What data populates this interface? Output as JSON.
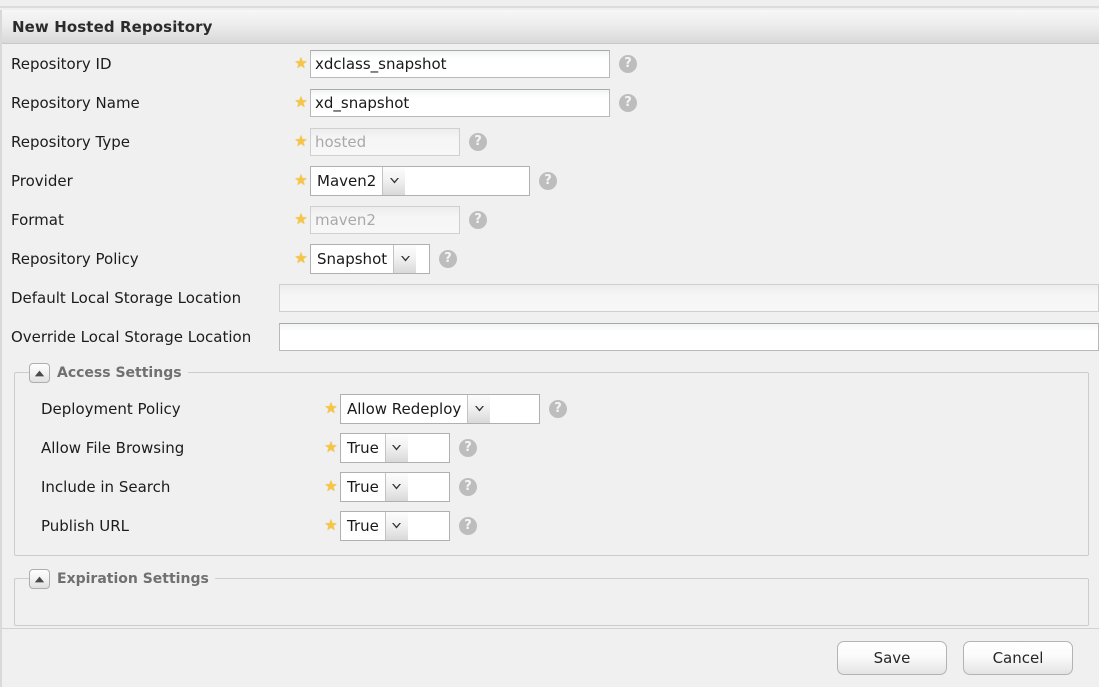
{
  "window": {
    "title": "New Hosted Repository"
  },
  "icons": {
    "help": "?",
    "required_star": "★",
    "collapse": "collapse-triangle-up"
  },
  "form": {
    "fields": [
      {
        "label": "Repository ID",
        "required": true,
        "control": "text",
        "value": "xdclass_snapshot",
        "disabled": false,
        "help": true
      },
      {
        "label": "Repository Name",
        "required": true,
        "control": "text",
        "value": "xd_snapshot",
        "disabled": false,
        "help": true
      },
      {
        "label": "Repository Type",
        "required": true,
        "control": "text",
        "value": "hosted",
        "disabled": true,
        "help": true
      },
      {
        "label": "Provider",
        "required": true,
        "control": "select",
        "value": "Maven2",
        "disabled": false,
        "help": true
      },
      {
        "label": "Format",
        "required": true,
        "control": "text",
        "value": "maven2",
        "disabled": true,
        "help": true
      },
      {
        "label": "Repository Policy",
        "required": true,
        "control": "select",
        "value": "Snapshot",
        "disabled": false,
        "help": true
      },
      {
        "label": "Default Local Storage Location",
        "required": false,
        "control": "text",
        "value": "",
        "disabled": true,
        "help": false
      },
      {
        "label": "Override Local Storage Location",
        "required": false,
        "control": "text",
        "value": "",
        "disabled": false,
        "help": false
      }
    ]
  },
  "access_settings": {
    "title": "Access Settings",
    "collapsed": false,
    "fields": [
      {
        "label": "Deployment Policy",
        "required": true,
        "control": "select",
        "value": "Allow Redeploy",
        "help": true
      },
      {
        "label": "Allow File Browsing",
        "required": true,
        "control": "select",
        "value": "True",
        "help": true
      },
      {
        "label": "Include in Search",
        "required": true,
        "control": "select",
        "value": "True",
        "help": true
      },
      {
        "label": "Publish URL",
        "required": true,
        "control": "select",
        "value": "True",
        "help": true
      }
    ]
  },
  "expiration_settings": {
    "title": "Expiration Settings",
    "collapsed": false
  },
  "footer": {
    "save_label": "Save",
    "cancel_label": "Cancel"
  },
  "colors": {
    "required_star": "#f6c544",
    "panel_bg": "#f0f0f0",
    "title_text": "#2b2b2b",
    "group_title": "#707070"
  }
}
